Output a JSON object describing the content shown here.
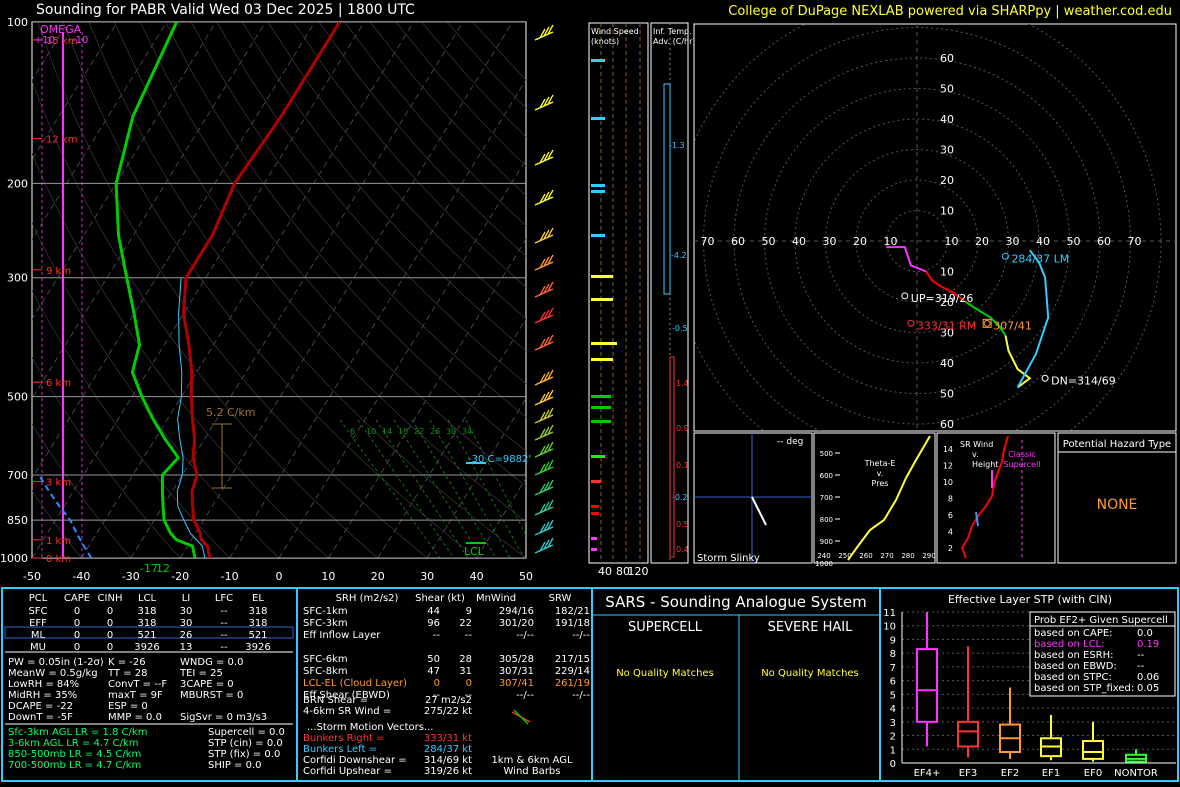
{
  "header": {
    "title": "Sounding for PABR Valid  Wed 03 Dec 2025 | 1800 UTC",
    "credit": "College of DuPage NEXLAB powered via SHARPpy | weather.cod.edu"
  },
  "colors": {
    "temp": "#e00000",
    "dew": "#00cc00",
    "wetbulb": "#33ccff",
    "isobar": "#888888",
    "storm": "#ffff33",
    "cyan": "#33ccff",
    "pink": "#ff33ff",
    "orange": "#ff9933",
    "panel_border": "#33ccff"
  },
  "chart_data": [
    {
      "type": "line",
      "name": "skewt",
      "pressure_levels": [
        100,
        200,
        300,
        500,
        700,
        850,
        1000
      ],
      "pressure_labels": [
        "100",
        "200",
        "300",
        "500",
        "700",
        "850",
        "1000"
      ],
      "x_ticks": [
        -50,
        -40,
        -30,
        -20,
        -10,
        0,
        10,
        20,
        30,
        40,
        50
      ],
      "x_tick_labels": [
        "-50",
        "-40",
        "-30",
        "-20",
        "-10",
        "0",
        "10",
        "20",
        "30",
        "40",
        "50"
      ],
      "height_labels": [
        {
          "p": 1000,
          "label": "0 km"
        },
        {
          "p": 925,
          "label": "1 km"
        },
        {
          "p": 720,
          "label": "3 km"
        },
        {
          "p": 470,
          "label": "6 km"
        },
        {
          "p": 290,
          "label": "9 km"
        },
        {
          "p": 165,
          "label": "12 km"
        },
        {
          "p": 108,
          "label": "15 km"
        }
      ],
      "omega_label": "OMEGA",
      "omega_scale": [
        "+10",
        "-10"
      ],
      "temperature": [
        [
          1000,
          -14
        ],
        [
          975,
          -15
        ],
        [
          950,
          -16
        ],
        [
          925,
          -18
        ],
        [
          900,
          -19
        ],
        [
          850,
          -22
        ],
        [
          800,
          -24
        ],
        [
          750,
          -26
        ],
        [
          700,
          -27
        ],
        [
          650,
          -30
        ],
        [
          600,
          -32
        ],
        [
          550,
          -35
        ],
        [
          500,
          -38
        ],
        [
          450,
          -41
        ],
        [
          400,
          -45
        ],
        [
          350,
          -50
        ],
        [
          300,
          -54
        ],
        [
          250,
          -54
        ],
        [
          200,
          -56
        ],
        [
          150,
          -55
        ],
        [
          100,
          -55
        ]
      ],
      "dewpoint": [
        [
          1000,
          -17
        ],
        [
          975,
          -18
        ],
        [
          950,
          -19
        ],
        [
          925,
          -23
        ],
        [
          900,
          -25
        ],
        [
          850,
          -28
        ],
        [
          800,
          -30
        ],
        [
          750,
          -32
        ],
        [
          700,
          -34
        ],
        [
          650,
          -33
        ],
        [
          600,
          -38
        ],
        [
          550,
          -43
        ],
        [
          500,
          -48
        ],
        [
          450,
          -53
        ],
        [
          400,
          -55
        ],
        [
          350,
          -60
        ],
        [
          300,
          -66
        ],
        [
          250,
          -73
        ],
        [
          200,
          -80
        ],
        [
          150,
          -85
        ],
        [
          100,
          -88
        ]
      ],
      "wetbulb": [
        [
          1000,
          -15
        ],
        [
          950,
          -17
        ],
        [
          900,
          -21
        ],
        [
          850,
          -24
        ],
        [
          800,
          -27
        ],
        [
          750,
          -29
        ],
        [
          700,
          -30
        ],
        [
          650,
          -32
        ],
        [
          600,
          -35
        ],
        [
          550,
          -38
        ],
        [
          500,
          -40
        ],
        [
          450,
          -43
        ],
        [
          400,
          -47
        ],
        [
          350,
          -51
        ],
        [
          300,
          -55
        ]
      ],
      "parcel": [
        [
          1000,
          -38
        ],
        [
          950,
          -41
        ],
        [
          900,
          -44
        ],
        [
          850,
          -47
        ],
        [
          800,
          -51
        ],
        [
          750,
          -55
        ],
        [
          700,
          -59
        ]
      ],
      "surface_temp_label": "-17",
      "surface_dew_label": "12",
      "lapse_rate_label": "5.2 C/km",
      "dgz_label": "-30 C=9882'",
      "lcl_label": "LCL",
      "mixing_ratio_labels": [
        "6",
        "10",
        "14",
        "18",
        "22",
        "26",
        "30",
        "34"
      ]
    },
    {
      "type": "line",
      "name": "hodograph",
      "rings": [
        10,
        20,
        30,
        40,
        50,
        60
      ],
      "ring_labels_top": [
        "60",
        "50",
        "40",
        "30",
        "20",
        "10"
      ],
      "ring_labels_bottom": [
        "10",
        "20",
        "30",
        "40",
        "50",
        "60"
      ],
      "ring_labels_x_left": [
        "70",
        "60",
        "50",
        "40",
        "30",
        "20",
        "10"
      ],
      "ring_labels_x_right": [
        "10",
        "20",
        "30",
        "40",
        "50",
        "60",
        "70"
      ],
      "trace": [
        [
          -10,
          -2
        ],
        [
          -4,
          -8
        ],
        [
          0,
          -10
        ],
        [
          3,
          -11
        ],
        [
          5,
          -13
        ],
        [
          8,
          -15
        ],
        [
          12,
          -17
        ],
        [
          16,
          -20
        ],
        [
          19,
          -22
        ],
        [
          24,
          -25
        ],
        [
          27,
          -28
        ],
        [
          29,
          -31
        ],
        [
          33,
          -38
        ],
        [
          37,
          -43
        ],
        [
          38,
          -47
        ],
        [
          33,
          -49
        ],
        [
          40,
          -17
        ],
        [
          42,
          -12
        ],
        [
          39,
          -7
        ],
        [
          37,
          -5
        ]
      ],
      "trace_colors": [
        "#ff33ff",
        "#ff0000",
        "#00cc00",
        "#ffff33",
        "#33ccff"
      ],
      "points": [
        {
          "u": -4,
          "v": -18,
          "label": "UP=319/26",
          "color": "#ffffff"
        },
        {
          "u": -2,
          "v": -27,
          "label": "333/31 RM",
          "color": "#ff3333"
        },
        {
          "u": 23,
          "v": -27,
          "label": "307/41",
          "color": "#ff9933"
        },
        {
          "u": 29,
          "v": -5,
          "label": "284/37 LM",
          "color": "#33ccff"
        },
        {
          "u": 42,
          "v": -45,
          "label": "DN=314/69",
          "color": "#ffffff"
        }
      ]
    }
  ],
  "side_panels": {
    "wind_speed_title": "Wind Speed (knots)",
    "wind_speed_ticks": [
      "40",
      "80",
      "120"
    ],
    "temp_adv_title": "Inf. Temp. Adv. (C/hr)",
    "temp_adv_values": [
      "-1.3",
      "-4.2",
      "-0.5",
      "1.4",
      "0.9",
      "0.1",
      "-0.2",
      "0.5",
      "0.4"
    ]
  },
  "storm_slinky": {
    "title": "Storm Slinky",
    "deg": "-- deg"
  },
  "theta_e": {
    "title_lines": [
      "Theta-E",
      "v.",
      "Pres"
    ],
    "y_ticks": [
      "500",
      "600",
      "700",
      "800",
      "900",
      "1000"
    ],
    "x_ticks": [
      "240",
      "250",
      "260",
      "270",
      "280",
      "290"
    ]
  },
  "sr_wind": {
    "title_lines": [
      "SR Wind",
      "v.",
      "Height"
    ],
    "label_lines": [
      "Classic",
      "Supercell"
    ],
    "y_ticks": [
      "14",
      "12",
      "10",
      "8",
      "6",
      "4",
      "2"
    ]
  },
  "hazard": {
    "title": "Potential Hazard Type",
    "value": "NONE"
  },
  "thermo_table": {
    "headers": [
      "PCL",
      "CAPE",
      "CINH",
      "LCL",
      "LI",
      "LFC",
      "EL"
    ],
    "rows": [
      [
        "SFC",
        "0",
        "0",
        "318",
        "30",
        "--",
        "318"
      ],
      [
        "EFF",
        "0",
        "0",
        "318",
        "30",
        "--",
        "318"
      ],
      [
        "ML",
        "0",
        "0",
        "521",
        "26",
        "--",
        "521"
      ],
      [
        "MU",
        "0",
        "0",
        "3926",
        "13",
        "--",
        "3926"
      ]
    ],
    "indices": [
      [
        "PW = 0.05in (1-2σ)",
        "K = -26",
        "WNDG = 0.0"
      ],
      [
        "MeanW = 0.5g/kg",
        "TT = 28",
        "TEI = 25"
      ],
      [
        "LowRH = 84%",
        "ConvT = --F",
        "3CAPE = 0"
      ],
      [
        "MidRH = 35%",
        "maxT = 9F",
        "MBURST = 0"
      ],
      [
        "DCAPE = -22",
        "ESP = 0",
        ""
      ],
      [
        "DownT = -5F",
        "MMP = 0.0",
        "SigSvr = 0 m3/s3"
      ]
    ],
    "lapse_rates": [
      "Sfc-3km AGL LR = 1.8 C/km",
      "3-6km AGL LR = 4.7 C/km",
      "850-500mb LR = 4.5 C/km",
      "700-500mb LR = 4.7 C/km"
    ],
    "composites": [
      "Supercell = 0.0",
      "STP (cin) = 0.0",
      "STP (fix) = 0.0",
      "SHIP = 0.0"
    ]
  },
  "kinematic_table": {
    "headers": [
      "SRH (m2/s2)",
      "Shear (kt)",
      "MnWind",
      "SRW"
    ],
    "rows": [
      [
        "SFC-1km",
        "44",
        "9",
        "294/16",
        "182/21"
      ],
      [
        "SFC-3km",
        "96",
        "22",
        "301/20",
        "191/18"
      ],
      [
        "Eff Inflow Layer",
        "--",
        "--",
        "--/--",
        "--/--"
      ],
      [
        "",
        "",
        " ",
        "",
        ""
      ],
      [
        "SFC-6km",
        "50",
        "28",
        "305/28",
        "217/15"
      ],
      [
        "SFC-8km",
        "47",
        "31",
        "307/31",
        "229/14"
      ],
      [
        "LCL-EL (Cloud Layer)",
        "0",
        "0",
        "307/41",
        "261/19"
      ],
      [
        "Eff Shear (EBWD)",
        "--",
        "--",
        "--/--",
        "--/--"
      ]
    ],
    "brn": [
      "BRN Shear =",
      "27 m2/s2"
    ],
    "srwind": [
      "4-6km SR Wind =",
      "275/22 kt"
    ],
    "storm_motion_title": "...Storm Motion Vectors...",
    "storm_motion": [
      [
        "Bunkers Right =",
        "333/31 kt"
      ],
      [
        "Bunkers Left =",
        "284/37 kt"
      ],
      [
        "Corfidi Downshear =",
        "314/69 kt"
      ],
      [
        "Corfidi Upshear =",
        "319/26 kt"
      ]
    ],
    "barbs_label": [
      "1km & 6km AGL",
      "Wind Barbs"
    ]
  },
  "sars": {
    "title": "SARS - Sounding Analogue System",
    "supercell": "SUPERCELL",
    "hail": "SEVERE HAIL",
    "supercell_result": "No Quality Matches",
    "hail_result": "No Quality Matches"
  },
  "stp": {
    "title": "Effective Layer STP (with CIN)",
    "y_ticks": [
      "11",
      "10",
      "9",
      "8",
      "7",
      "6",
      "5",
      "4",
      "3",
      "2",
      "1",
      "0"
    ],
    "categories": [
      "EF4+",
      "EF3",
      "EF2",
      "EF1",
      "EF0",
      "NONTOR"
    ],
    "box_colors": [
      "#ff33ff",
      "#ff3333",
      "#ff9933",
      "#ffff33",
      "#ffff33",
      "#33ff33"
    ],
    "boxes": [
      [
        1.2,
        3.0,
        5.3,
        8.3,
        11.0
      ],
      [
        0.4,
        1.2,
        2.3,
        3.0,
        8.5
      ],
      [
        0.3,
        0.8,
        1.8,
        2.8,
        5.5
      ],
      [
        0.2,
        0.5,
        1.2,
        1.8,
        3.5
      ],
      [
        0.1,
        0.3,
        0.8,
        1.6,
        3.0
      ],
      [
        0.0,
        0.1,
        0.3,
        0.6,
        1.0
      ]
    ],
    "legend_title": "Prob EF2+ Given Supercell",
    "legend": [
      [
        "based on CAPE:",
        "0.0"
      ],
      [
        "based on LCL:",
        "0.19"
      ],
      [
        "based on ESRH:",
        "--"
      ],
      [
        "based on EBWD:",
        "--"
      ],
      [
        "based on STPC:",
        "0.06"
      ],
      [
        "based on STP_fixed:",
        "0.05"
      ]
    ]
  }
}
